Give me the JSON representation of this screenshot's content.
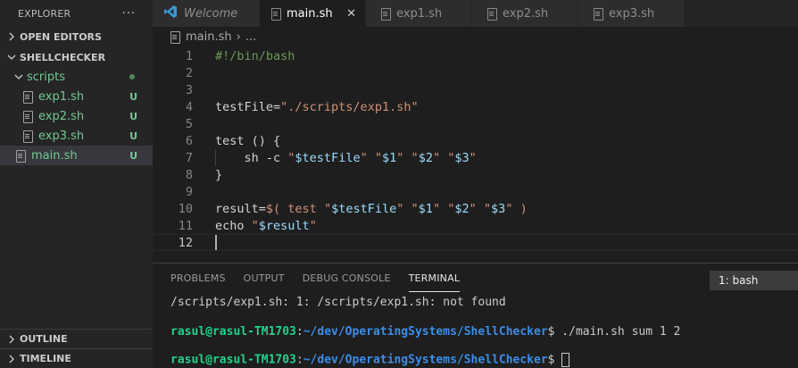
{
  "sidebar": {
    "title": "EXPLORER",
    "more": "···",
    "open_editors": "OPEN EDITORS",
    "project": "SHELLCHECKER",
    "tree": [
      {
        "label": "scripts",
        "badge": ""
      },
      {
        "label": "exp1.sh",
        "badge": "U"
      },
      {
        "label": "exp2.sh",
        "badge": "U"
      },
      {
        "label": "exp3.sh",
        "badge": "U"
      },
      {
        "label": "main.sh",
        "badge": "U"
      }
    ],
    "outline": "OUTLINE",
    "timeline": "TIMELINE"
  },
  "tabs": [
    {
      "label": "Welcome"
    },
    {
      "label": "main.sh",
      "close": "✕"
    },
    {
      "label": "exp1.sh"
    },
    {
      "label": "exp2.sh"
    },
    {
      "label": "exp3.sh"
    }
  ],
  "breadcrumb": {
    "file": "main.sh",
    "sep": "›",
    "more": "..."
  },
  "editor": {
    "line_numbers": [
      "1",
      "2",
      "3",
      "4",
      "5",
      "6",
      "7",
      "8",
      "9",
      "10",
      "11",
      "12"
    ],
    "lines": {
      "l1": "#!/bin/bash",
      "l4_a": "testFile=",
      "l4_b": "\"./scripts/exp1.sh\"",
      "l6": "test () {",
      "l7_a": "    sh -c ",
      "l7_b": "\"",
      "l7_c": "$testFile",
      "l7_d": "\"",
      "l7_e": " ",
      "l7_f": "\"",
      "l7_g": "$1",
      "l7_h": "\"",
      "l7_i": " ",
      "l7_j": "\"",
      "l7_k": "$2",
      "l7_l": "\"",
      "l7_m": " ",
      "l7_n": "\"",
      "l7_o": "$3",
      "l7_p": "\"",
      "l8": "}",
      "l10_a": "result=",
      "l10_b": "$(",
      "l10_c": " test ",
      "l10_d": "\"",
      "l10_e": "$testFile",
      "l10_f": "\"",
      "l10_g": " ",
      "l10_h": "\"",
      "l10_i": "$1",
      "l10_j": "\"",
      "l10_k": " ",
      "l10_l": "\"",
      "l10_m": "$2",
      "l10_n": "\"",
      "l10_o": " ",
      "l10_p": "\"",
      "l10_q": "$3",
      "l10_r": "\"",
      "l10_s": " )",
      "l11_a": "echo ",
      "l11_b": "\"",
      "l11_c": "$result",
      "l11_d": "\""
    }
  },
  "panel": {
    "tabs": [
      "PROBLEMS",
      "OUTPUT",
      "DEBUG CONSOLE",
      "TERMINAL"
    ],
    "terminal_select": "1: bash",
    "terminal": {
      "line1": "/scripts/exp1.sh: 1: /scripts/exp1.sh: not found",
      "user": "rasul@rasul-TM1703",
      "colon": ":",
      "path": "~/dev/OperatingSystems/ShellChecker",
      "cmd1": "$ ./main.sh sum 1 2",
      "prompt2": "$ "
    }
  },
  "colors": {
    "git_untracked": "#73c991",
    "terminal_user": "#23d18b",
    "terminal_path": "#3b8eea",
    "vscode_blue": "#3c99d4"
  }
}
